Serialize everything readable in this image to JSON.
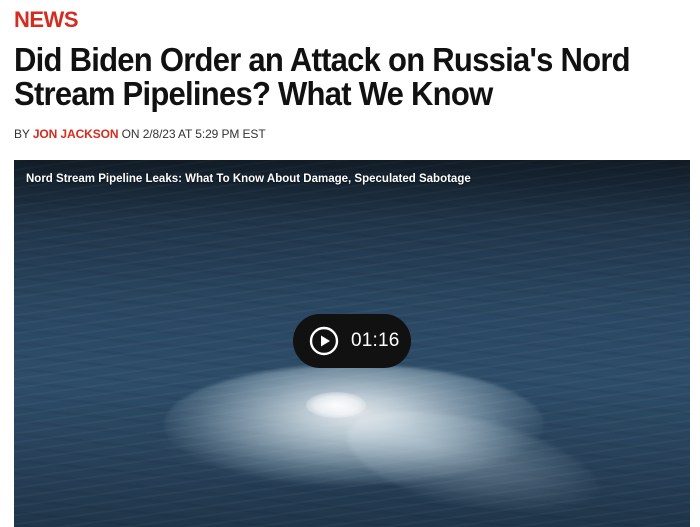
{
  "article": {
    "section": "NEWS",
    "headline": "Did Biden Order an Attack on Russia's Nord Stream Pipelines? What We Know",
    "byline": {
      "prefix": "BY ",
      "author": "JON JACKSON",
      "date_text": " ON 2/8/23 AT 5:29 PM EST"
    }
  },
  "video": {
    "title": "Nord Stream Pipeline Leaks: What To Know About Damage, Speculated Sabotage",
    "duration": "01:16",
    "play_icon": "play-circle-icon"
  },
  "colors": {
    "accent": "#d62b1f",
    "headline": "#111111",
    "play_pill": "#111111"
  }
}
